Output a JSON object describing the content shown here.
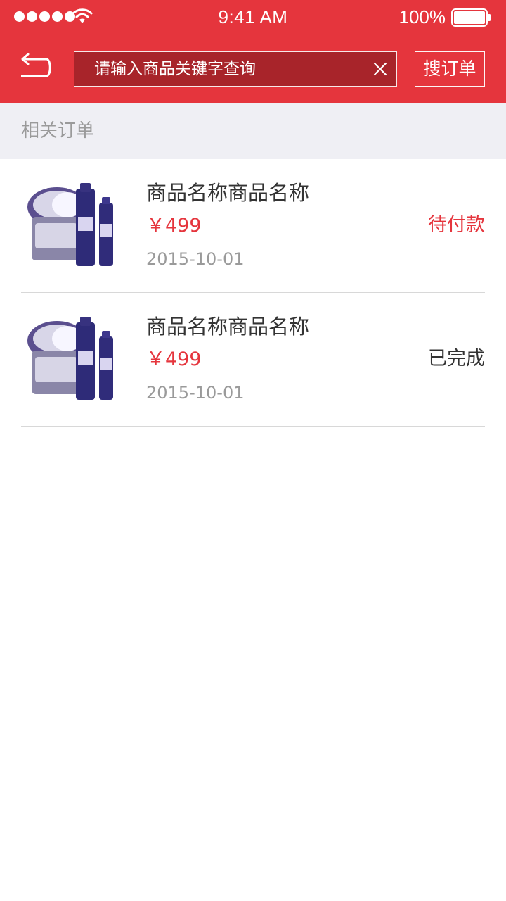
{
  "status_bar": {
    "time": "9:41 AM",
    "battery": "100%"
  },
  "header": {
    "search_placeholder": "请输入商品关键字查询",
    "search_button_label": "搜订单"
  },
  "section": {
    "title": "相关订单"
  },
  "orders": [
    {
      "name": "商品名称商品名称",
      "price": "￥499",
      "date": "2015-10-01",
      "status": "待付款",
      "status_color": "#e5353d"
    },
    {
      "name": "商品名称商品名称",
      "price": "￥499",
      "date": "2015-10-01",
      "status": "已完成",
      "status_color": "#333333"
    }
  ],
  "icons": {
    "back": "back-return-icon",
    "clear": "close-icon",
    "wifi": "wifi-icon",
    "battery": "battery-icon"
  }
}
